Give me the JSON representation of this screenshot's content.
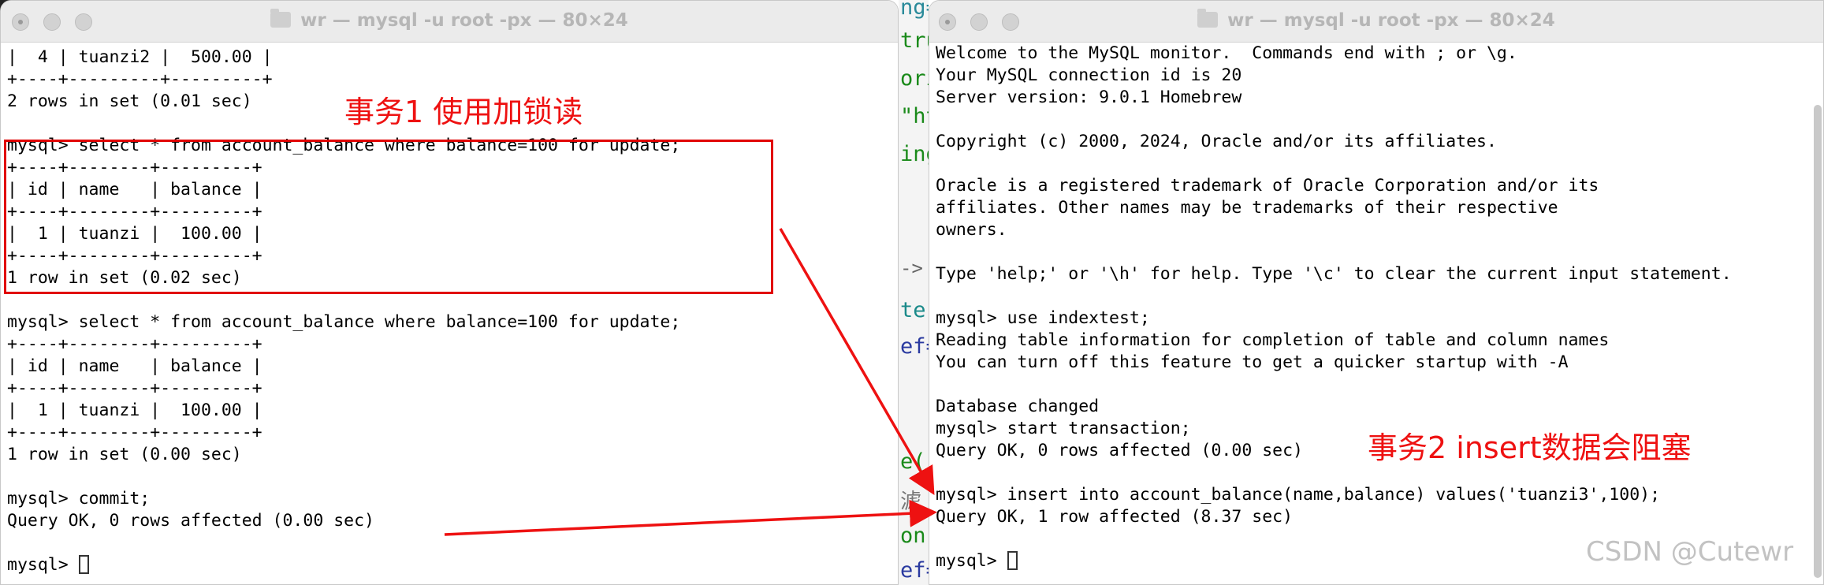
{
  "left_window": {
    "title": "wr — mysql -u root -px — 80×24",
    "lines": [
      "|  4 | tuanzi2 |  500.00 |",
      "+----+---------+---------+",
      "2 rows in set (0.01 sec)",
      "",
      "mysql> select * from account_balance where balance=100 for update;",
      "+----+--------+---------+",
      "| id | name   | balance |",
      "+----+--------+---------+",
      "|  1 | tuanzi |  100.00 |",
      "+----+--------+---------+",
      "1 row in set (0.02 sec)",
      "",
      "mysql> select * from account_balance where balance=100 for update;",
      "+----+--------+---------+",
      "| id | name   | balance |",
      "+----+--------+---------+",
      "|  1 | tuanzi |  100.00 |",
      "+----+--------+---------+",
      "1 row in set (0.00 sec)",
      "",
      "mysql> commit;",
      "Query OK, 0 rows affected (0.00 sec)",
      "",
      "mysql> "
    ]
  },
  "right_window": {
    "title": "wr — mysql -u root -px — 80×24",
    "lines": [
      "Welcome to the MySQL monitor.  Commands end with ; or \\g.",
      "Your MySQL connection id is 20",
      "Server version: 9.0.1 Homebrew",
      "",
      "Copyright (c) 2000, 2024, Oracle and/or its affiliates.",
      "",
      "Oracle is a registered trademark of Oracle Corporation and/or its",
      "affiliates. Other names may be trademarks of their respective",
      "owners.",
      "",
      "Type 'help;' or '\\h' for help. Type '\\c' to clear the current input statement.",
      "",
      "mysql> use indextest;",
      "Reading table information for completion of table and column names",
      "You can turn off this feature to get a quicker startup with -A",
      "",
      "Database changed",
      "mysql> start transaction;",
      "Query OK, 0 rows affected (0.00 sec)",
      "",
      "mysql> insert into account_balance(name,balance) values('tuanzi3',100);",
      "Query OK, 1 row affected (8.37 sec)",
      "",
      "mysql> "
    ]
  },
  "background_editor": {
    "fragments": [
      "ng=",
      "tru",
      "ori",
      "\"ht",
      "ing",
      "->",
      "ter",
      "ef=",
      "e(",
      "滤",
      "on'",
      "ef="
    ]
  },
  "annotations": {
    "tx1": "事务1 使用加锁读",
    "tx2": "事务2 insert数据会阻塞",
    "color": "#ee1111"
  },
  "watermark": "CSDN @Cutewr",
  "icons": [
    "folder-icon",
    "close-light-icon",
    "minimize-light-icon",
    "zoom-light-icon",
    "cursor-block-icon"
  ]
}
